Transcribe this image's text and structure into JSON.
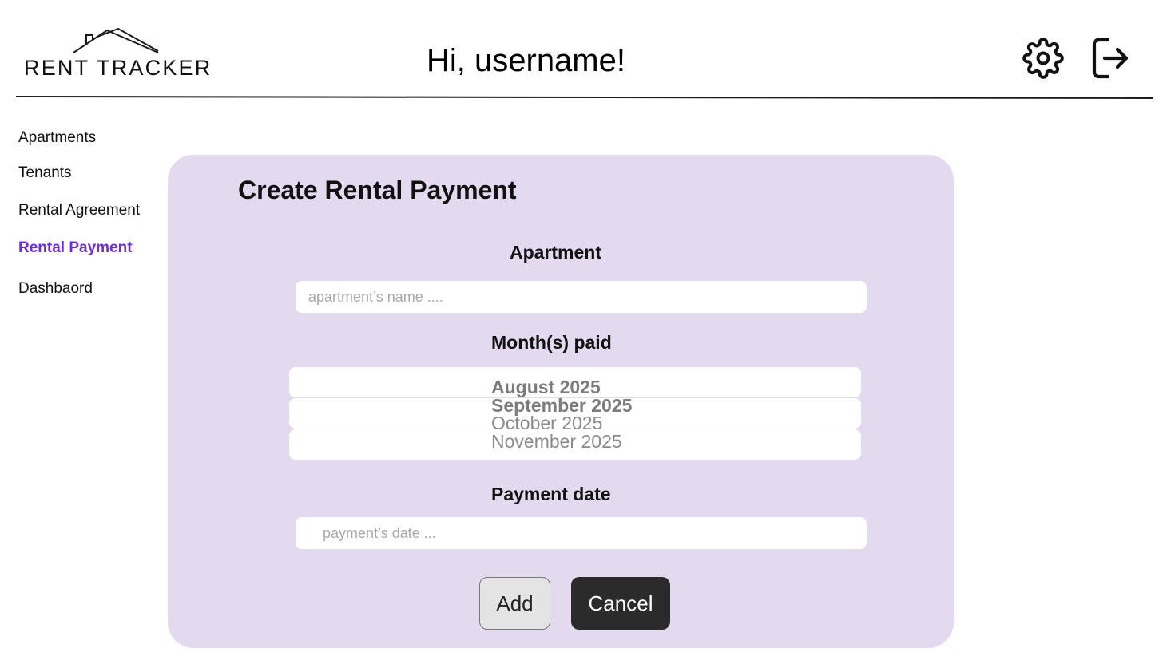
{
  "app": {
    "logo_text": "RENT TRACKER",
    "greeting": "Hi, username!"
  },
  "header": {
    "icons": [
      "gear-icon",
      "logout-icon"
    ]
  },
  "sidebar": {
    "items": [
      {
        "label": "Apartments",
        "active": false
      },
      {
        "label": "Tenants",
        "active": false
      },
      {
        "label": "Rental Agreement",
        "active": false
      },
      {
        "label": "Rental Payment",
        "active": true
      },
      {
        "label": "Dashbaord",
        "active": false
      }
    ]
  },
  "form": {
    "title": "Create Rental Payment",
    "apartment": {
      "label": "Apartment",
      "placeholder": "apartment’s name ....",
      "value": ""
    },
    "months": {
      "label": "Month(s) paid",
      "options": [
        {
          "label": "August 2025",
          "selected": true
        },
        {
          "label": "September 2025",
          "selected": true
        },
        {
          "label": "October 2025",
          "selected": false
        },
        {
          "label": "November 2025",
          "selected": false
        }
      ]
    },
    "payment_date": {
      "label": "Payment date",
      "placeholder": "payment’s date ...",
      "value": ""
    },
    "add_label": "Add",
    "cancel_label": "Cancel"
  },
  "colors": {
    "accent": "#6a2ce8",
    "card_background": "#e3daef",
    "cancel_background": "#2b2b2b",
    "add_background": "#e4e4e4"
  }
}
